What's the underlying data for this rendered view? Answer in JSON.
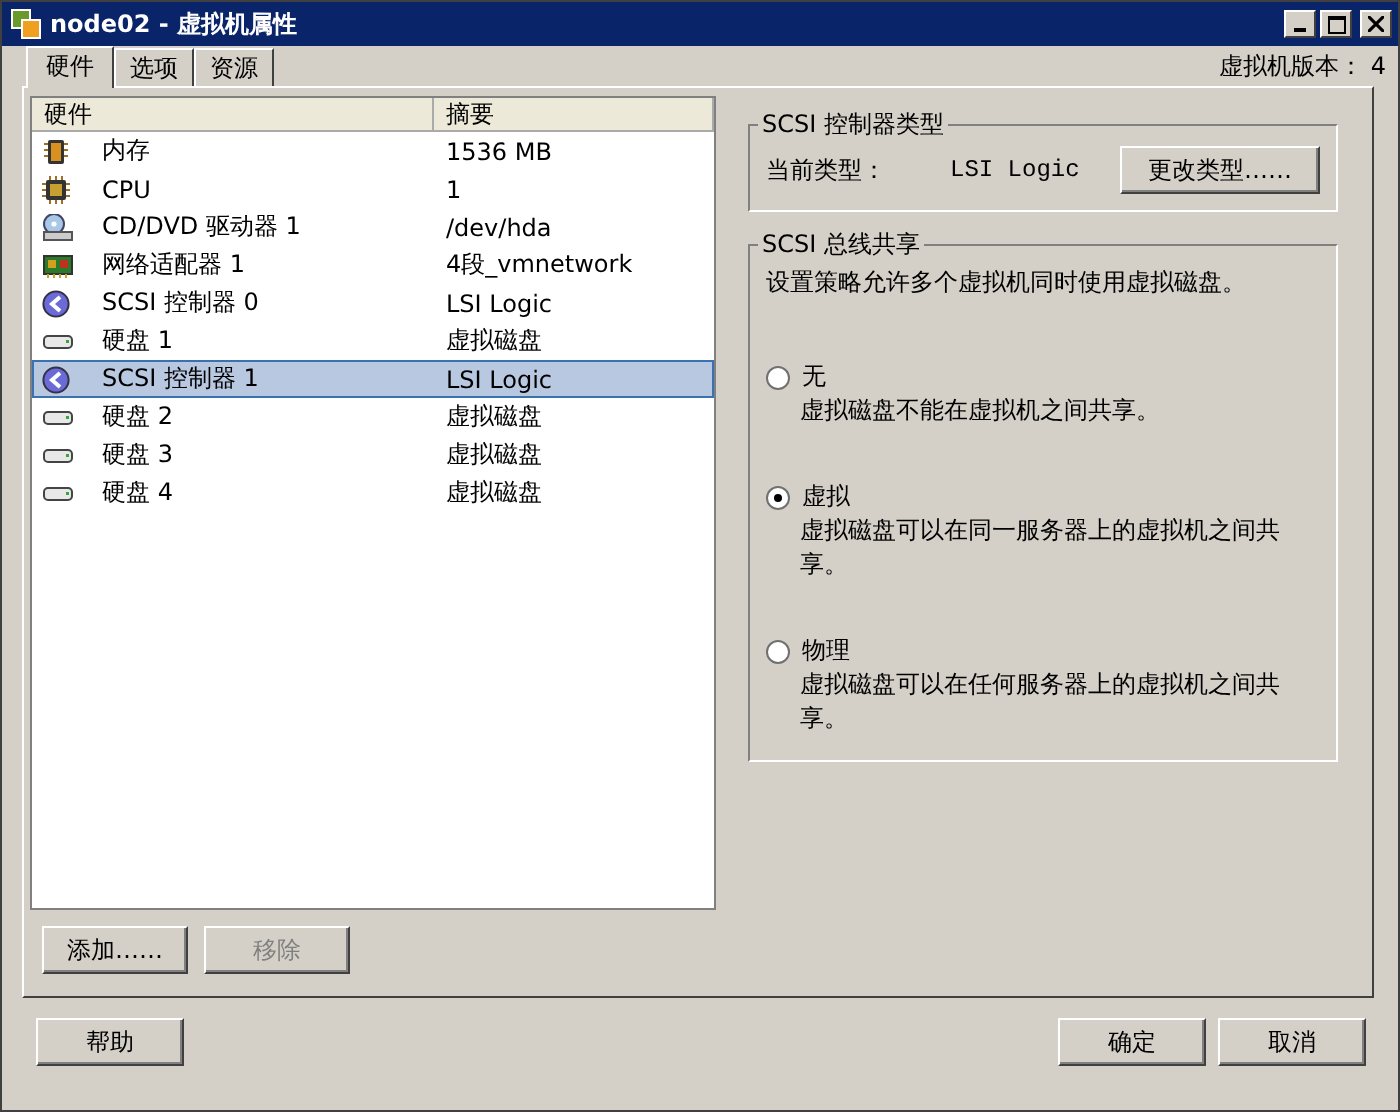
{
  "window": {
    "title": "node02 - 虚拟机属性"
  },
  "tabs": [
    {
      "label": "硬件",
      "selected": true
    },
    {
      "label": "选项",
      "selected": false
    },
    {
      "label": "资源",
      "selected": false
    }
  ],
  "vm_version": "虚拟机版本： 4",
  "hardware": {
    "columns": [
      "硬件",
      "摘要"
    ],
    "rows": [
      {
        "kind": "memory",
        "name": "内存",
        "summary": "1536 MB",
        "selected": false
      },
      {
        "kind": "cpu",
        "name": "CPU",
        "summary": "1",
        "selected": false
      },
      {
        "kind": "cdrom",
        "name": "CD/DVD 驱动器 1",
        "summary": "/dev/hda",
        "selected": false
      },
      {
        "kind": "nic",
        "name": "网络适配器 1",
        "summary": "4段_vmnetwork",
        "selected": false
      },
      {
        "kind": "scsi",
        "name": "SCSI 控制器 0",
        "summary": "LSI Logic",
        "selected": false
      },
      {
        "kind": "disk",
        "name": "硬盘 1",
        "summary": "虚拟磁盘",
        "selected": false
      },
      {
        "kind": "scsi",
        "name": "SCSI 控制器 1",
        "summary": "LSI Logic",
        "selected": true
      },
      {
        "kind": "disk",
        "name": "硬盘 2",
        "summary": "虚拟磁盘",
        "selected": false
      },
      {
        "kind": "disk",
        "name": "硬盘 3",
        "summary": "虚拟磁盘",
        "selected": false
      },
      {
        "kind": "disk",
        "name": "硬盘 4",
        "summary": "虚拟磁盘",
        "selected": false
      }
    ]
  },
  "list_buttons": [
    {
      "label": "添加……",
      "disabled": false
    },
    {
      "label": "移除",
      "disabled": true
    }
  ],
  "controller_type": {
    "title": "SCSI 控制器类型",
    "label": "当前类型：",
    "value": "LSI Logic",
    "button": "更改类型……"
  },
  "bus_sharing": {
    "title": "SCSI 总线共享",
    "description": "设置策略允许多个虚拟机同时使用虚拟磁盘。",
    "options": [
      {
        "label": "无",
        "description": "虚拟磁盘不能在虚拟机之间共享。",
        "selected": false
      },
      {
        "label": "虚拟",
        "description": "虚拟磁盘可以在同一服务器上的虚拟机之间共享。",
        "selected": true
      },
      {
        "label": "物理",
        "description": "虚拟磁盘可以在任何服务器上的虚拟机之间共享。",
        "selected": false
      }
    ]
  },
  "footer_left": [
    "帮助"
  ],
  "footer_right": [
    "确定",
    "取消"
  ]
}
